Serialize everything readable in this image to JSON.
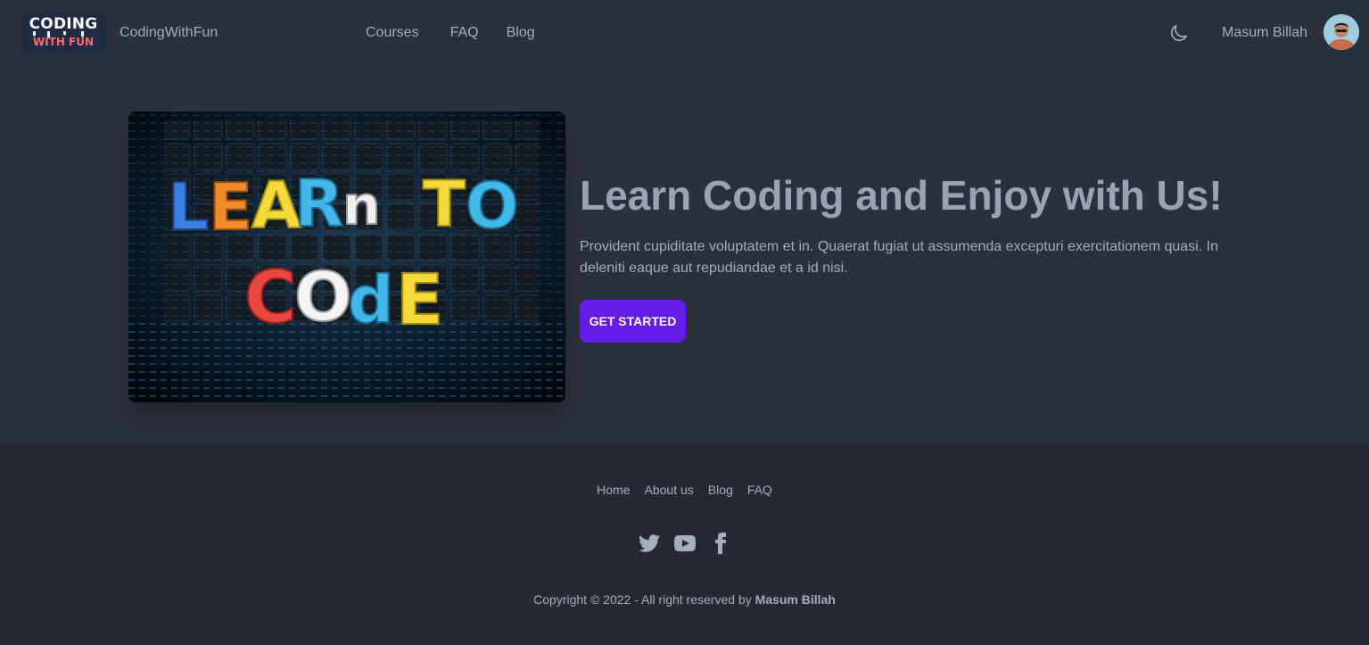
{
  "navbar": {
    "logo": {
      "line1": "CODING",
      "line2": "WITH FUN"
    },
    "brand": "CodingWithFun",
    "links": [
      "Courses",
      "FAQ",
      "Blog"
    ],
    "theme_icon": "moon-icon",
    "user_name": "Masum Billah"
  },
  "hero": {
    "image_words": [
      "LEARn",
      "TO",
      "COdE"
    ],
    "title": "Learn Coding and Enjoy with Us!",
    "text": "Provident cupiditate voluptatem et in. Quaerat fugiat ut assumenda excepturi exercitationem quasi. In deleniti eaque aut repudiandae et a id nisi.",
    "button": "GET STARTED"
  },
  "footer": {
    "links": [
      "Home",
      "About us",
      "Blog",
      "FAQ"
    ],
    "social_icons": [
      "twitter-icon",
      "youtube-icon",
      "facebook-icon"
    ],
    "copyright_prefix": "Copyright © 2022 - All right reserved by",
    "copyright_name": "Masum Billah"
  },
  "colors": {
    "background": "#2a303c",
    "footer_background": "#242933",
    "primary_button": "#661ae6",
    "text": "#a6adbb"
  }
}
